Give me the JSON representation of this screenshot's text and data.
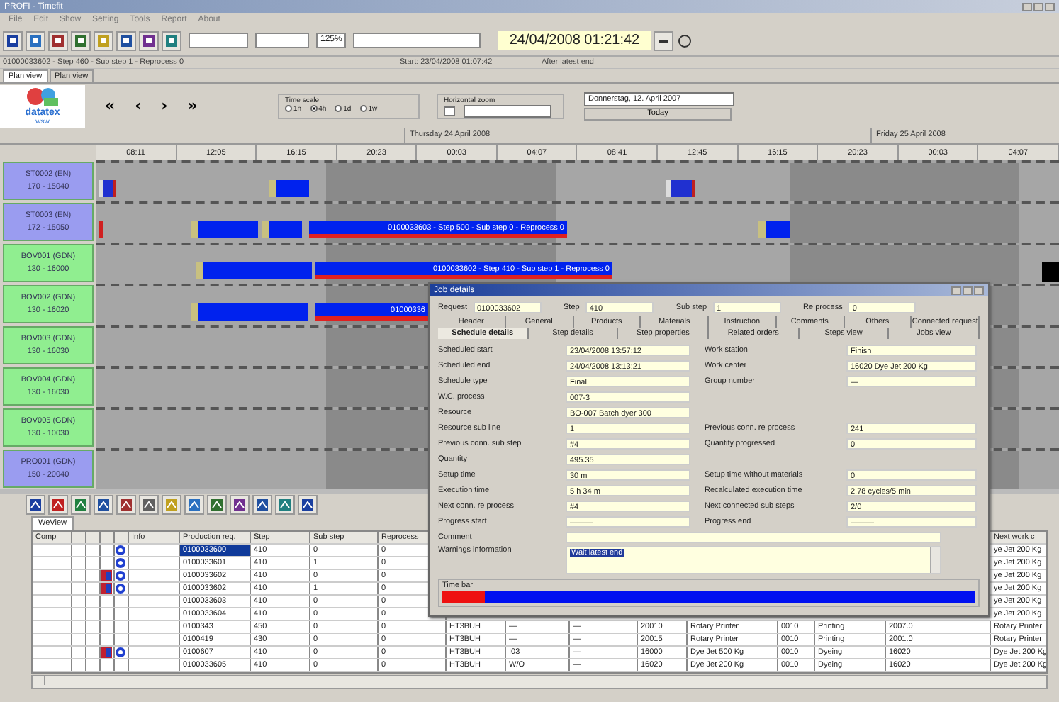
{
  "window": {
    "title": "PROFI - Timefit"
  },
  "menu": [
    "File",
    "Edit",
    "Show",
    "Setting",
    "Tools",
    "Report",
    "About"
  ],
  "toolbar": {
    "zoom": "125%",
    "datetime": "24/04/2008 01:21:42"
  },
  "status": [
    "01000033602 - Step 460 - Sub step 1 - Reprocess 0",
    "Start: 23/04/2008 01:07:42",
    "After latest end"
  ],
  "view_tabs": [
    {
      "label": "Plan view",
      "selected": true
    },
    {
      "label": "Plan view",
      "selected": false
    }
  ],
  "logo": {
    "name": "datatex",
    "sub": "wsw"
  },
  "nav": [
    "«",
    "‹",
    "›",
    "»"
  ],
  "time_scale": {
    "title": "Time scale",
    "options": [
      {
        "label": "1h",
        "selected": false
      },
      {
        "label": "4h",
        "selected": true
      },
      {
        "label": "1d",
        "selected": false
      },
      {
        "label": "1w",
        "selected": false
      }
    ]
  },
  "horizontal_zoom": {
    "title": "Horizontal zoom",
    "checked": false
  },
  "calendar": {
    "value": "Donnerstag, 12. April 2007",
    "button": "Today"
  },
  "timeline": {
    "days": [
      {
        "label": "Thursday 24 April 2008"
      },
      {
        "label": "Friday 25 April 2008"
      }
    ],
    "ticks": [
      "08:11",
      "12:05",
      "16:15",
      "20:23",
      "00:03",
      "04:07",
      "08:41",
      "12:45",
      "16:15",
      "20:23",
      "00:03",
      "04:07"
    ]
  },
  "resources": [
    {
      "name": "ST0002 (EN)",
      "range": "170 - 15040",
      "color": "#9a9cf0"
    },
    {
      "name": "ST0003 (EN)",
      "range": "172 - 15050",
      "color": "#9a9cf0",
      "bar_label": "0100033603 - Step 500 - Sub step 0 - Reprocess 0"
    },
    {
      "name": "BOV001 (GDN)",
      "range": "130 - 16000",
      "color": "#90ee90",
      "bar_label": "0100033602 - Step 410 - Sub step 1 - Reprocess 0"
    },
    {
      "name": "BOV002 (GDN)",
      "range": "130 - 16020",
      "color": "#90ee90",
      "bar_label": "01000336"
    },
    {
      "name": "BOV003 (GDN)",
      "range": "130 - 16030",
      "color": "#90ee90"
    },
    {
      "name": "BOV004 (GDN)",
      "range": "130 - 16030",
      "color": "#90ee90"
    },
    {
      "name": "BOV005 (GDN)",
      "range": "130 - 10030",
      "color": "#90ee90"
    },
    {
      "name": "PRO001 (GDN)",
      "range": "150 - 20040",
      "color": "#9a9cf0"
    }
  ],
  "bottom_tab": "WeView",
  "table": {
    "columns": [
      "Comp",
      "Info",
      "Production req.",
      "Step",
      "Sub step",
      "Reprocess",
      "Next work c"
    ],
    "rows": [
      {
        "selected": true,
        "mark_a": false,
        "mark_b": true,
        "cells": [
          "",
          "",
          "0100033600",
          "410",
          "0",
          "0"
        ],
        "last": "ye Jet 200 Kg"
      },
      {
        "selected": false,
        "mark_a": false,
        "mark_b": true,
        "cells": [
          "",
          "",
          "0100033601",
          "410",
          "1",
          "0"
        ],
        "last": "ye Jet 200 Kg"
      },
      {
        "selected": false,
        "mark_a": true,
        "mark_b": true,
        "cells": [
          "",
          "",
          "0100033602",
          "410",
          "0",
          "0"
        ],
        "last": "ye Jet 200 Kg"
      },
      {
        "selected": false,
        "mark_a": true,
        "mark_b": true,
        "cells": [
          "",
          "",
          "0100033602",
          "410",
          "1",
          "0"
        ],
        "last": "ye Jet 200 Kg"
      },
      {
        "selected": false,
        "mark_a": false,
        "mark_b": false,
        "cells": [
          "",
          "",
          "0100033603",
          "410",
          "0",
          "0"
        ],
        "last": "ye Jet 200 Kg"
      },
      {
        "selected": false,
        "mark_a": false,
        "mark_b": false,
        "cells": [
          "",
          "",
          "0100033604",
          "410",
          "0",
          "0"
        ],
        "last": "ye Jet 200 Kg"
      },
      {
        "selected": false,
        "mark_a": false,
        "mark_b": false,
        "cells": [
          "",
          "",
          "0100343",
          "450",
          "0",
          "0"
        ],
        "middle": [
          "HT3BUH",
          "—",
          "—",
          "20010",
          "Rotary Printer",
          "0010",
          "Printing",
          "2007.0"
        ],
        "last": "Rotary Printer"
      },
      {
        "selected": false,
        "mark_a": false,
        "mark_b": false,
        "cells": [
          "",
          "",
          "0100419",
          "430",
          "0",
          "0"
        ],
        "middle": [
          "HT3BUH",
          "—",
          "—",
          "20015",
          "Rotary Printer",
          "0010",
          "Printing",
          "2001.0"
        ],
        "last": "Rotary Printer"
      },
      {
        "selected": false,
        "mark_a": true,
        "mark_b": true,
        "cells": [
          "",
          "",
          "0100607",
          "410",
          "0",
          "0"
        ],
        "middle": [
          "HT3BUH",
          "I03",
          "—",
          "16000",
          "Dye Jet 500 Kg",
          "0010",
          "Dyeing",
          "16020"
        ],
        "last": "Dye Jet 200 Kg"
      },
      {
        "selected": false,
        "mark_a": false,
        "mark_b": false,
        "cells": [
          "",
          "",
          "0100033605",
          "410",
          "0",
          "0"
        ],
        "middle": [
          "HT3BUH",
          "W/O",
          "—",
          "16020",
          "Dye Jet 200 Kg",
          "0010",
          "Dyeing",
          "16020"
        ],
        "last": "Dye Jet 200 Kg"
      }
    ]
  },
  "dialog": {
    "title": "Job details",
    "header": [
      {
        "label": "Request",
        "value": "0100033602"
      },
      {
        "label": "Step",
        "value": "410"
      },
      {
        "label": "Sub step",
        "value": "1"
      },
      {
        "label": "Re process",
        "value": "0"
      }
    ],
    "tabs_row1": [
      {
        "label": "Header",
        "selected": false
      },
      {
        "label": "General",
        "selected": false
      },
      {
        "label": "Products",
        "selected": false
      },
      {
        "label": "Materials",
        "selected": false
      },
      {
        "label": "Instruction",
        "selected": false
      },
      {
        "label": "Comments",
        "selected": false
      },
      {
        "label": "Others",
        "selected": false
      },
      {
        "label": "Connected request",
        "selected": false
      }
    ],
    "tabs_row2": [
      {
        "label": "Schedule details",
        "selected": true
      },
      {
        "label": "Step details",
        "selected": false
      },
      {
        "label": "Step properties",
        "selected": false
      },
      {
        "label": "Related orders",
        "selected": false
      },
      {
        "label": "Steps view",
        "selected": false
      },
      {
        "label": "Jobs view",
        "selected": false
      }
    ],
    "fields": [
      {
        "label": "Scheduled start",
        "value": "23/04/2008 13:57:12",
        "right_label": "Work station",
        "right_value": "Finish"
      },
      {
        "label": "Scheduled end",
        "value": "24/04/2008 13:13:21",
        "right_label": "Work center",
        "right_value": "16020   Dye Jet 200 Kg"
      },
      {
        "label": "Schedule type",
        "value": "Final",
        "right_label": "Group number",
        "right_value": "—"
      },
      {
        "label": "W.C. process",
        "value": "007-3"
      },
      {
        "label": "Resource",
        "value": "BO-007   Batch dyer 300"
      },
      {
        "label": "Resource sub line",
        "value": "1",
        "right_label": "Previous conn. re process",
        "right_value": "241"
      },
      {
        "label": "Previous conn. sub step",
        "value": "#4",
        "right_label": "Quantity progressed",
        "right_value": "0"
      },
      {
        "label": "Quantity",
        "value": "495.35"
      },
      {
        "label": "Setup time",
        "value": "30 m",
        "right_label": "Setup time without materials",
        "right_value": "0"
      },
      {
        "label": "Execution time",
        "value": "5 h 34 m",
        "right_label": "Recalculated execution time",
        "right_value": "2.78 cycles/5 min"
      },
      {
        "label": "Next conn. re process",
        "value": "#4",
        "right_label": "Next connected sub steps",
        "right_value": "2/0"
      },
      {
        "label": "Progress start",
        "value": "———",
        "right_label": "Progress end",
        "right_value": "———"
      }
    ],
    "comment_label": "Comment",
    "warnings_label": "Warnings information",
    "warning": "Wait latest end",
    "time_bar": {
      "label": "Time bar",
      "level": 0.08
    }
  }
}
